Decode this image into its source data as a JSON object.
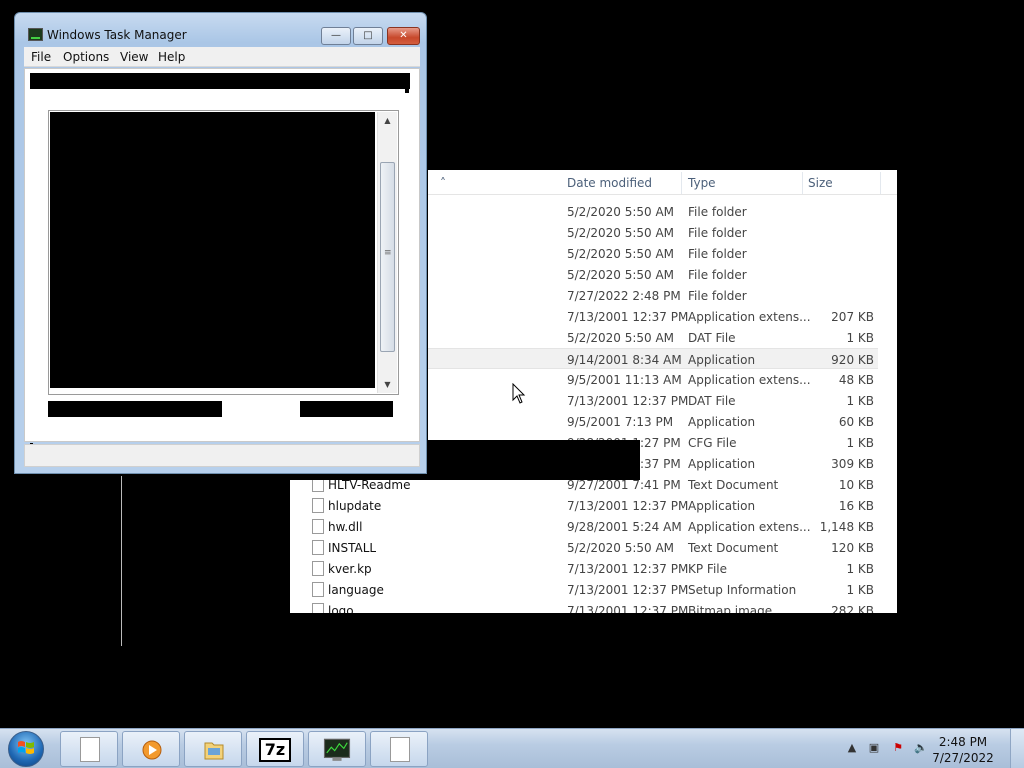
{
  "task_manager": {
    "title": "Windows Task Manager",
    "menu": [
      "File",
      "Options",
      "View",
      "Help"
    ],
    "caption_buttons": {
      "minimize": "—",
      "maximize": "□",
      "close": "✕"
    }
  },
  "explorer": {
    "columns": {
      "date": "Date modified",
      "type": "Type",
      "size": "Size"
    },
    "rows": [
      {
        "name": "",
        "date": "5/2/2020 5:50 AM",
        "type": "File folder",
        "size": ""
      },
      {
        "name": "",
        "date": "5/2/2020 5:50 AM",
        "type": "File folder",
        "size": ""
      },
      {
        "name": "",
        "date": "5/2/2020 5:50 AM",
        "type": "File folder",
        "size": ""
      },
      {
        "name": "",
        "date": "5/2/2020 5:50 AM",
        "type": "File folder",
        "size": ""
      },
      {
        "name": "",
        "date": "7/27/2022 2:48 PM",
        "type": "File folder",
        "size": ""
      },
      {
        "name": "",
        "date": "7/13/2001 12:37 PM",
        "type": "Application extens...",
        "size": "207 KB"
      },
      {
        "name": "",
        "date": "5/2/2020 5:50 AM",
        "type": "DAT File",
        "size": "1 KB"
      },
      {
        "name": "",
        "date": "9/14/2001 8:34 AM",
        "type": "Application",
        "size": "920 KB"
      },
      {
        "name": "",
        "date": "9/5/2001 11:13 AM",
        "type": "Application extens...",
        "size": "48 KB"
      },
      {
        "name": "",
        "date": "7/13/2001 12:37 PM",
        "type": "DAT File",
        "size": "1 KB"
      },
      {
        "name": "",
        "date": "9/5/2001 7:13 PM",
        "type": "Application",
        "size": "60 KB"
      },
      {
        "name": "",
        "date": "9/28/2001 1:27 PM",
        "type": "CFG File",
        "size": "1 KB"
      },
      {
        "name": "",
        "date": "9/27/2001 7:37 PM",
        "type": "Application",
        "size": "309 KB"
      },
      {
        "name": "HLTV-Readme",
        "date": "9/27/2001 7:41 PM",
        "type": "Text Document",
        "size": "10 KB"
      },
      {
        "name": "hlupdate",
        "date": "7/13/2001 12:37 PM",
        "type": "Application",
        "size": "16 KB"
      },
      {
        "name": "hw.dll",
        "date": "9/28/2001 5:24 AM",
        "type": "Application extens...",
        "size": "1,148 KB"
      },
      {
        "name": "INSTALL",
        "date": "5/2/2020 5:50 AM",
        "type": "Text Document",
        "size": "120 KB"
      },
      {
        "name": "kver.kp",
        "date": "7/13/2001 12:37 PM",
        "type": "KP File",
        "size": "1 KB"
      },
      {
        "name": "language",
        "date": "7/13/2001 12:37 PM",
        "type": "Setup Information",
        "size": "1 KB"
      },
      {
        "name": "logo",
        "date": "7/13/2001 12:37 PM",
        "type": "Bitmap image",
        "size": "282 KB"
      }
    ]
  },
  "taskbar": {
    "buttons": [
      "document",
      "media-player",
      "file-explorer",
      "7-zip",
      "task-manager",
      "document"
    ],
    "seven_zip_label": "7z",
    "clock_time": "2:48 PM",
    "clock_date": "7/27/2022"
  },
  "colors": {
    "taskbar": "#b9cce3",
    "close_button": "#c7482b"
  }
}
